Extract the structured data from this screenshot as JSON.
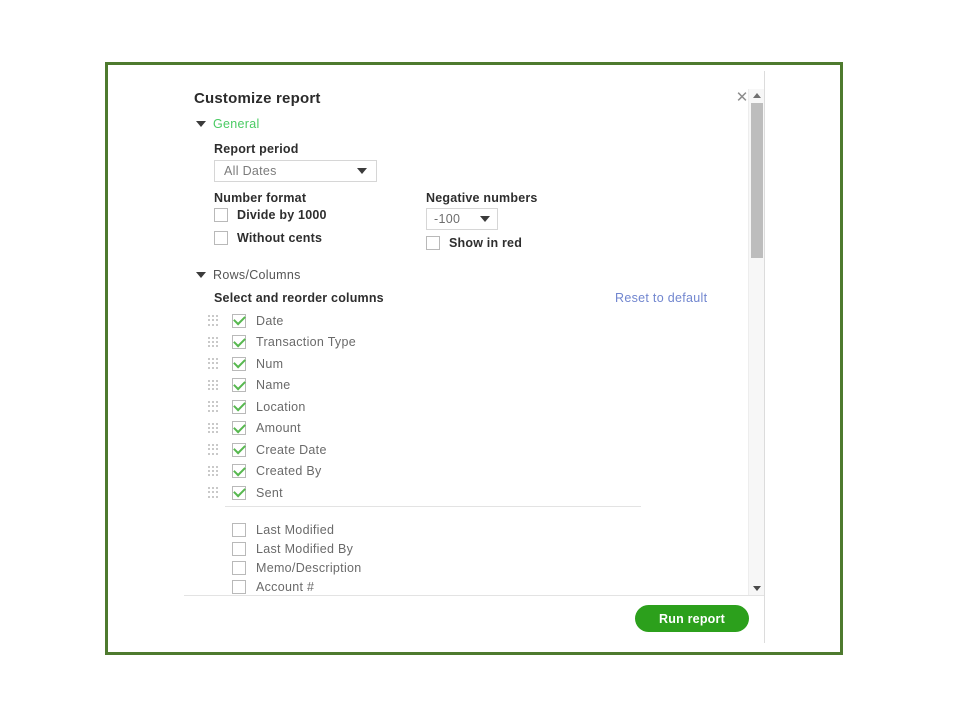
{
  "dialog": {
    "title": "Customize report",
    "close_icon": "close-x-icon"
  },
  "sections": {
    "general": {
      "label": "General",
      "caret_icon": "caret-down-icon"
    },
    "rows_columns": {
      "label": "Rows/Columns",
      "caret_icon": "caret-down-icon"
    }
  },
  "general": {
    "report_period_label": "Report period",
    "report_period_value": "All Dates",
    "number_format_label": "Number format",
    "negative_numbers_label": "Negative numbers",
    "negative_numbers_value": "-100",
    "checkboxes": [
      {
        "label": "Divide by 1000",
        "checked": false
      },
      {
        "label": "Without cents",
        "checked": false
      }
    ],
    "show_in_red": {
      "label": "Show in red",
      "checked": false
    }
  },
  "rows_columns": {
    "select_reorder_label": "Select and reorder columns",
    "reset_link": "Reset to default",
    "selected_columns": [
      {
        "label": "Date",
        "checked": true
      },
      {
        "label": "Transaction Type",
        "checked": true
      },
      {
        "label": "Num",
        "checked": true
      },
      {
        "label": "Name",
        "checked": true
      },
      {
        "label": "Location",
        "checked": true
      },
      {
        "label": "Amount",
        "checked": true
      },
      {
        "label": "Create Date",
        "checked": true
      },
      {
        "label": "Created By",
        "checked": true
      },
      {
        "label": "Sent",
        "checked": true
      }
    ],
    "available_columns": [
      {
        "label": "Last Modified",
        "checked": false
      },
      {
        "label": "Last Modified By",
        "checked": false
      },
      {
        "label": "Memo/Description",
        "checked": false
      },
      {
        "label": "Account #",
        "checked": false
      }
    ]
  },
  "footer": {
    "run_report_label": "Run report"
  },
  "scrollbar": {
    "up_arrow_icon": "scroll-up-arrow-icon",
    "down_arrow_icon": "scroll-down-arrow-icon"
  },
  "colors": {
    "frame_green": "#4e7a2e",
    "section_green": "#4acb63",
    "check_green": "#57b84f",
    "button_green": "#2ca01c",
    "link_blue": "#7186cf"
  }
}
